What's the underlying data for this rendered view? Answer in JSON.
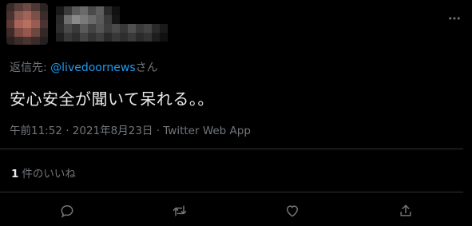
{
  "tweet": {
    "reply_prefix": "返信先: ",
    "reply_mention": "@livedoornews",
    "reply_suffix": "さん",
    "text": "安心安全が聞いて呆れる。。",
    "timestamp": "午前11:52 · 2021年8月23日 · Twitter Web App",
    "like_count": "1",
    "like_label": "件のいいね"
  },
  "icons": {
    "more": "more-icon",
    "reply": "reply-icon",
    "retweet": "retweet-icon",
    "like": "heart-icon",
    "share": "share-icon"
  },
  "colors": {
    "background": "#000000",
    "text": "#e7e9ea",
    "secondary": "#71767b",
    "accent": "#1d9bf0",
    "divider": "#2f3336"
  }
}
